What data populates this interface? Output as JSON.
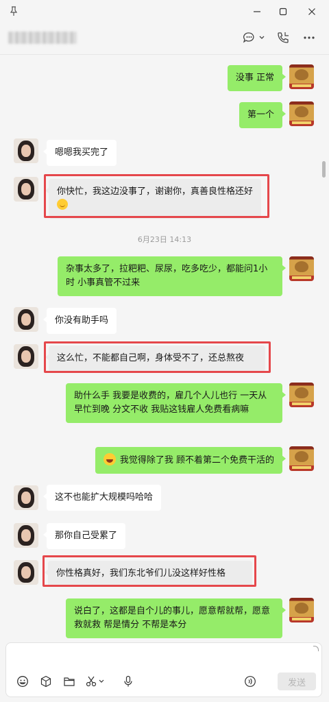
{
  "window": {
    "contact_name": "▓▓▓▓ ▓▓▓▓"
  },
  "messages": [
    {
      "id": "m1",
      "side": "self",
      "text": "没事  正常"
    },
    {
      "id": "m2",
      "side": "self",
      "text": "第一个"
    },
    {
      "id": "m3",
      "side": "other",
      "text": "嗯嗯我买完了"
    },
    {
      "id": "m4",
      "side": "other",
      "text": "你快忙，我这边没事了，谢谢你，真善良性格还好",
      "emoji": "smile-emoji",
      "highlighted": true
    },
    {
      "id": "m5",
      "side": "self",
      "text": "杂事太多了，拉粑粑、尿尿，吃多吃少，都能问1小时  小事真管不过来"
    },
    {
      "id": "m6",
      "side": "other",
      "text": "你没有助手吗"
    },
    {
      "id": "m7",
      "side": "other",
      "text": "这么忙，不能都自己啊，身体受不了，还总熬夜",
      "highlighted": true
    },
    {
      "id": "m8",
      "side": "self",
      "text": "助什么手   我要是收费的，雇几个人儿也行  一天从早忙到晚 分文不收  我贴这钱雇人免费看病嘛"
    },
    {
      "id": "m9",
      "side": "self",
      "text": "我觉得除了我  顾不着第二个免费干活的",
      "emoji": "laugh-emoji"
    },
    {
      "id": "m10",
      "side": "other",
      "text": "这不也能扩大规模吗哈哈"
    },
    {
      "id": "m11",
      "side": "other",
      "text": "那你自己受累了"
    },
    {
      "id": "m12",
      "side": "other",
      "text": "你性格真好，我们东北爷们儿没这样好性格",
      "highlighted": true
    },
    {
      "id": "m13",
      "side": "self",
      "text": "说白了，这都是自个儿的事儿，愿意帮就帮，愿意救就救  帮是情分 不帮是本分"
    }
  ],
  "timestamp": "6月23日 14:13",
  "input": {
    "value": "",
    "send_label": "发送"
  },
  "colors": {
    "self_bubble": "#95ec69",
    "other_bubble": "#ffffff",
    "highlight_box": "#e5474b",
    "background": "#f5f5f5"
  },
  "icons": {
    "titlebar": [
      "pin-icon",
      "minimize-icon",
      "maximize-icon",
      "close-icon"
    ],
    "header": [
      "chat-bubble-icon",
      "phone-call-icon",
      "more-icon"
    ],
    "toolbar": [
      "emoji-icon",
      "sticker-box-icon",
      "folder-icon",
      "scissors-icon",
      "microphone-icon",
      "voice-input-icon"
    ]
  }
}
